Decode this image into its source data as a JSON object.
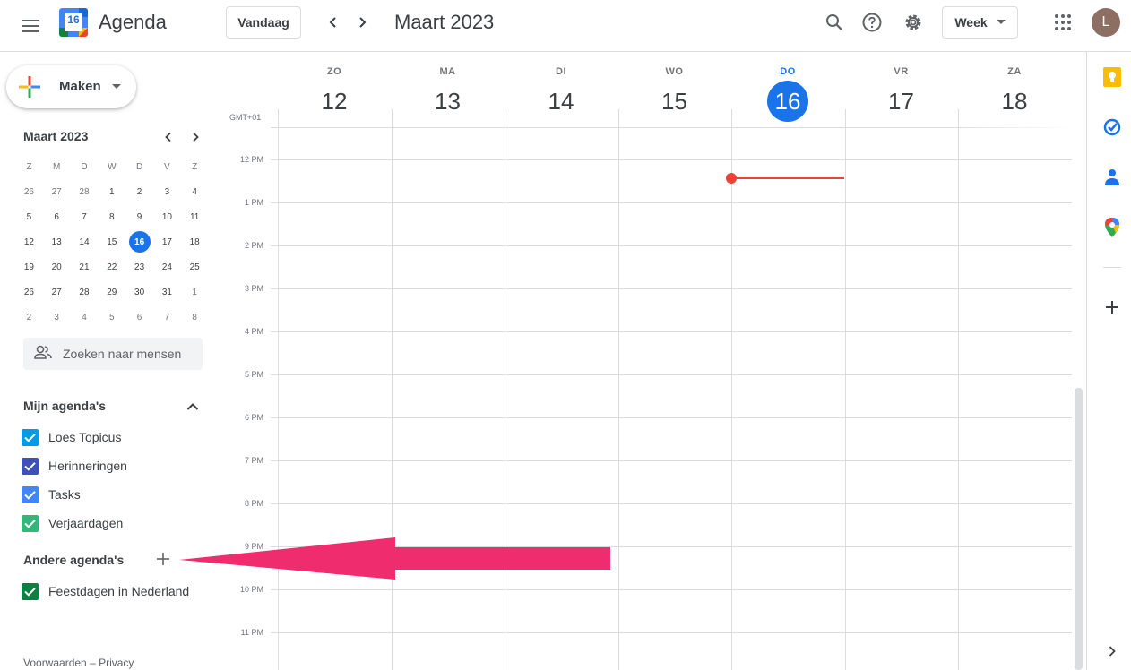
{
  "header": {
    "app_title": "Agenda",
    "logo_day": "16",
    "today_label": "Vandaag",
    "period_title": "Maart 2023",
    "view_label": "Week",
    "avatar_initial": "L"
  },
  "sidebar": {
    "create_label": "Maken",
    "mini_calendar": {
      "title": "Maart 2023",
      "weekday_headers": [
        "Z",
        "M",
        "D",
        "W",
        "D",
        "V",
        "Z"
      ],
      "weeks": [
        [
          "26",
          "27",
          "28",
          "1",
          "2",
          "3",
          "4"
        ],
        [
          "5",
          "6",
          "7",
          "8",
          "9",
          "10",
          "11"
        ],
        [
          "12",
          "13",
          "14",
          "15",
          "16",
          "17",
          "18"
        ],
        [
          "19",
          "20",
          "21",
          "22",
          "23",
          "24",
          "25"
        ],
        [
          "26",
          "27",
          "28",
          "29",
          "30",
          "31",
          "1"
        ],
        [
          "2",
          "3",
          "4",
          "5",
          "6",
          "7",
          "8"
        ]
      ],
      "today": "16"
    },
    "people_search_placeholder": "Zoeken naar mensen",
    "my_calendars_title": "Mijn agenda's",
    "my_calendars": [
      {
        "label": "Loes Topicus",
        "color": "#039be5"
      },
      {
        "label": "Herinneringen",
        "color": "#3f51b5"
      },
      {
        "label": "Tasks",
        "color": "#4285f4"
      },
      {
        "label": "Verjaardagen",
        "color": "#33b679"
      }
    ],
    "other_calendars_title": "Andere agenda's",
    "other_calendars": [
      {
        "label": "Feestdagen in Nederland",
        "color": "#0b8043"
      }
    ],
    "footer_terms": "Voorwaarden",
    "footer_sep": "–",
    "footer_privacy": "Privacy"
  },
  "week": {
    "timezone": "GMT+01",
    "days": [
      {
        "name": "ZO",
        "num": "12",
        "today": false
      },
      {
        "name": "MA",
        "num": "13",
        "today": false
      },
      {
        "name": "DI",
        "num": "14",
        "today": false
      },
      {
        "name": "WO",
        "num": "15",
        "today": false
      },
      {
        "name": "DO",
        "num": "16",
        "today": true
      },
      {
        "name": "VR",
        "num": "17",
        "today": false
      },
      {
        "name": "ZA",
        "num": "18",
        "today": false
      }
    ],
    "hours": [
      "12 PM",
      "1 PM",
      "2 PM",
      "3 PM",
      "4 PM",
      "5 PM",
      "6 PM",
      "7 PM",
      "8 PM",
      "9 PM",
      "10 PM",
      "11 PM"
    ]
  },
  "colors": {
    "accent": "#1a73e8",
    "now_line": "#ea4335",
    "arrow": "#ee2c6e"
  },
  "icons": {
    "header": [
      "menu-icon",
      "search-icon",
      "help-icon",
      "settings-icon",
      "apps-grid-icon"
    ],
    "side_panel": [
      "keep-icon",
      "tasks-icon",
      "contacts-icon",
      "maps-icon",
      "add-icon",
      "chevron-right-icon"
    ]
  }
}
